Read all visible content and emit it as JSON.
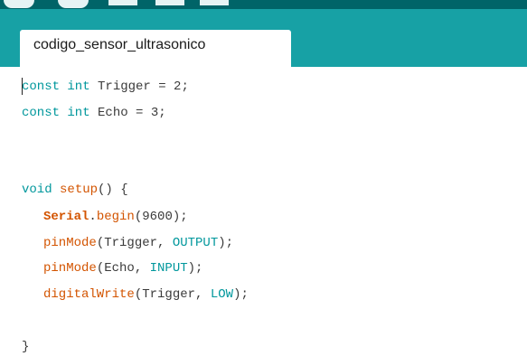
{
  "window": {
    "tab_name": "codigo_sensor_ultrasonico"
  },
  "colors": {
    "header": "#17a1a5",
    "top_strip": "#006468",
    "keyword": "#00979c",
    "function": "#d35400",
    "text": "#3a3a3a"
  },
  "code": {
    "line1": {
      "kw": "const int",
      "rest": " Trigger = 2;"
    },
    "line2": {
      "kw": "const int",
      "rest": " Echo = 3;"
    },
    "line5": {
      "kw": "void",
      "fn": "setup",
      "rest": "() {"
    },
    "line6": {
      "obj": "Serial",
      "dot": ".",
      "fn": "begin",
      "rest": "(9600);"
    },
    "line7": {
      "fn": "pinMode",
      "rest1": "(Trigger, ",
      "const": "OUTPUT",
      "rest2": ");"
    },
    "line8": {
      "fn": "pinMode",
      "rest1": "(Echo, ",
      "const": "INPUT",
      "rest2": ");"
    },
    "line9": {
      "fn": "digitalWrite",
      "rest1": "(Trigger, ",
      "const": "LOW",
      "rest2": ");"
    },
    "line11": {
      "rest": "}"
    }
  }
}
